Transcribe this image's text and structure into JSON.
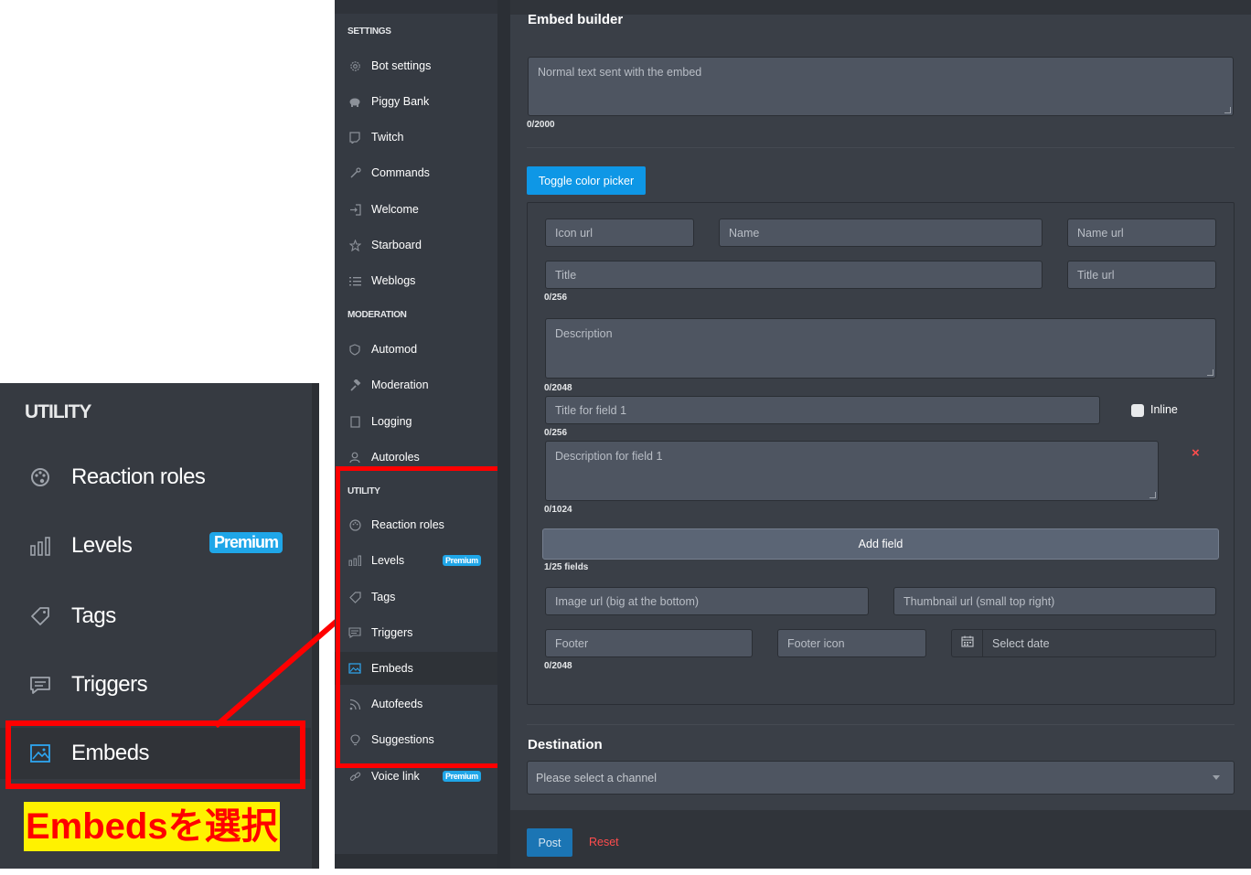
{
  "zoom": {
    "heading": "UTILITY",
    "items": [
      {
        "label": "Reaction roles",
        "icon": "palette-icon"
      },
      {
        "label": "Levels",
        "icon": "bar-chart-icon",
        "badge": "Premium"
      },
      {
        "label": "Tags",
        "icon": "tag-icon"
      },
      {
        "label": "Triggers",
        "icon": "chat-icon"
      },
      {
        "label": "Embeds",
        "icon": "image-icon",
        "active": true
      }
    ],
    "caption": "Embedsを選択"
  },
  "sidebar": {
    "settings_heading": "SETTINGS",
    "settings": [
      {
        "label": "Bot settings",
        "icon": "gear-icon"
      },
      {
        "label": "Piggy Bank",
        "icon": "piggy-bank-icon"
      },
      {
        "label": "Twitch",
        "icon": "twitch-icon"
      },
      {
        "label": "Commands",
        "icon": "wrench-icon"
      },
      {
        "label": "Welcome",
        "icon": "sign-in-icon"
      },
      {
        "label": "Starboard",
        "icon": "star-icon"
      },
      {
        "label": "Weblogs",
        "icon": "list-icon"
      }
    ],
    "moderation_heading": "MODERATION",
    "moderation": [
      {
        "label": "Automod",
        "icon": "shield-icon"
      },
      {
        "label": "Moderation",
        "icon": "hammer-icon"
      },
      {
        "label": "Logging",
        "icon": "document-icon"
      },
      {
        "label": "Autoroles",
        "icon": "user-icon"
      }
    ],
    "utility_heading": "UTILITY",
    "utility": [
      {
        "label": "Reaction roles",
        "icon": "palette-icon"
      },
      {
        "label": "Levels",
        "icon": "bar-chart-icon",
        "badge": "Premium"
      },
      {
        "label": "Tags",
        "icon": "tag-icon"
      },
      {
        "label": "Triggers",
        "icon": "chat-icon"
      },
      {
        "label": "Embeds",
        "icon": "image-icon",
        "active": true
      },
      {
        "label": "Autofeeds",
        "icon": "rss-icon"
      },
      {
        "label": "Suggestions",
        "icon": "lightbulb-icon"
      },
      {
        "label": "Voice link",
        "icon": "link-icon",
        "badge": "Premium"
      }
    ]
  },
  "main": {
    "title": "Embed builder",
    "message_placeholder": "Normal text sent with the embed",
    "message_count": "0/2000",
    "toggle_color_label": "Toggle color picker",
    "embed": {
      "icon_url_placeholder": "Icon url",
      "name_placeholder": "Name",
      "name_url_placeholder": "Name url",
      "title_placeholder": "Title",
      "title_url_placeholder": "Title url",
      "title_count": "0/256",
      "description_placeholder": "Description",
      "description_count": "0/2048",
      "field_title_placeholder": "Title for field 1",
      "inline_label": "Inline",
      "field_title_count": "0/256",
      "field_desc_placeholder": "Description for field 1",
      "remove_field": "×",
      "field_desc_count": "0/1024",
      "add_field_label": "Add field",
      "fields_count": "1/25 fields",
      "image_url_placeholder": "Image url (big at the bottom)",
      "thumbnail_url_placeholder": "Thumbnail url (small top right)",
      "footer_placeholder": "Footer",
      "footer_icon_placeholder": "Footer icon",
      "date_placeholder": "Select date",
      "footer_count": "0/2048"
    },
    "destination_title": "Destination",
    "channel_placeholder": "Please select a channel",
    "post_label": "Post",
    "reset_label": "Reset"
  },
  "colors": {
    "accent": "#0e97e6",
    "premium_badge": "#1fa6e8",
    "highlight": "#ff0000",
    "caption_bg": "#fff200",
    "danger": "#ff4d4d"
  }
}
